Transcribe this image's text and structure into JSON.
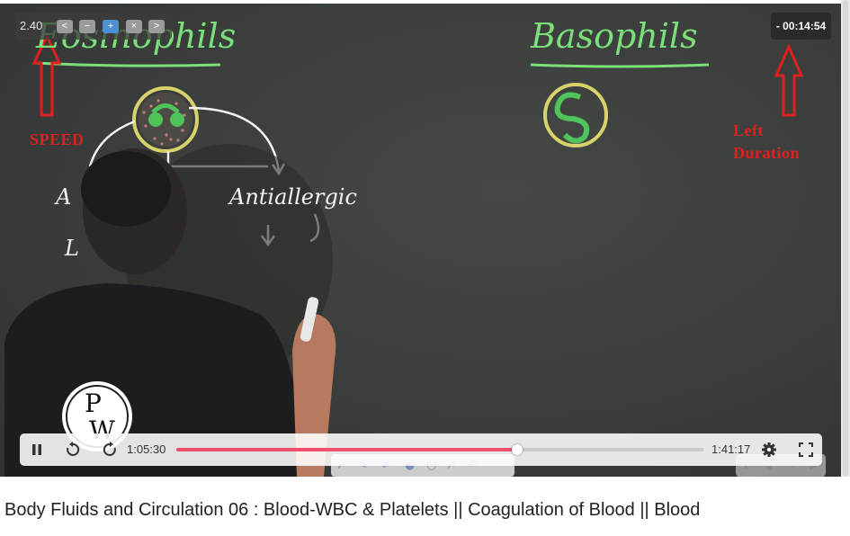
{
  "player": {
    "speed_value": "2.40",
    "speed_controls": [
      "<",
      "−",
      "+",
      "×",
      ">"
    ],
    "time_left": "- 00:14:54",
    "current_time": "1:05:30",
    "total_time": "1:41:17",
    "progress_fraction": 0.647
  },
  "board": {
    "heading_left": "Eosinophils",
    "heading_right": "Basophils",
    "word_antiallergic": "Antiallergic",
    "fragment_a": "A",
    "fragment_l": "L"
  },
  "annotations": {
    "speed_label": "SPEED",
    "left_label_line1": "Left",
    "left_label_line2": "Duration"
  },
  "logo": {
    "text_top": "P",
    "text_bottom": "W"
  },
  "video_title": "Body Fluids and Circulation 06 : Blood-WBC & Platelets || Coagulation of Blood || Blood",
  "colors": {
    "chalk_green": "#7be07a",
    "annotation_red": "#e0201e",
    "progress_fill": "#f0506e"
  }
}
